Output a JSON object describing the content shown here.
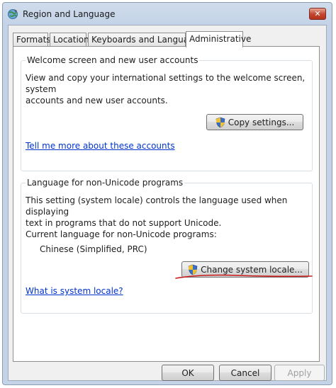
{
  "window": {
    "title": "Region and Language",
    "close_label": "✕"
  },
  "tabs": [
    {
      "label": "Formats"
    },
    {
      "label": "Location"
    },
    {
      "label": "Keyboards and Languages"
    },
    {
      "label": "Administrative"
    }
  ],
  "welcome_group": {
    "title": "Welcome screen and new user accounts",
    "description_line1": "View and copy your international settings to the welcome screen, system",
    "description_line2": "accounts and new user accounts.",
    "copy_button": "Copy settings...",
    "link": "Tell me more about these accounts"
  },
  "non_unicode_group": {
    "title": "Language for non-Unicode programs",
    "description_line1": "This setting (system locale) controls the language used when displaying",
    "description_line2": "text in programs that do not support Unicode.",
    "current_label": "Current language for non-Unicode programs:",
    "current_value": "Chinese (Simplified, PRC)",
    "change_button": "Change system locale...",
    "link": "What is system locale?"
  },
  "footer": {
    "ok": "OK",
    "cancel": "Cancel",
    "apply": "Apply"
  },
  "icons": {
    "title": "globe-icon",
    "admin": "uac-shield-icon"
  },
  "colors": {
    "link": "#0033cc",
    "annotation": "#cc1a1a",
    "close_button": "#c2452e"
  }
}
